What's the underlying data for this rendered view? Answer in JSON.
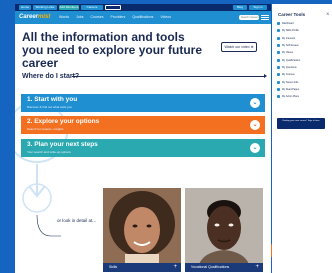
{
  "topbar": {
    "pills": [
      "Home",
      "Working Links",
      "Add Members",
      "Careers",
      "",
      "Blog",
      "Sign in"
    ]
  },
  "nav": {
    "brand_main": "Career",
    "brand_accent": "mist",
    "links": [
      "Words",
      "Jobs",
      "Courses",
      "Providers",
      "Qualifications",
      "Videos"
    ],
    "search_placeholder": "Search Careers"
  },
  "hero": {
    "title": "All the information and tools you need to explore your future career",
    "button_label": "Watch our video"
  },
  "where": {
    "heading": "Where do I start?"
  },
  "steps": [
    {
      "title": "1. Start with you",
      "subtitle": "Discover & find out what suits you",
      "color": "#1f8fd1"
    },
    {
      "title": "2. Explore your options",
      "subtitle": "Search for careers, insights",
      "color": "#f37021"
    },
    {
      "title": "3. Plan your next steps",
      "subtitle": "Your search and write-up options",
      "color": "#2aa9b0"
    }
  ],
  "detail": {
    "label": "or look in detail at..."
  },
  "cards": [
    {
      "label": "Skills",
      "icon": "plus-icon"
    },
    {
      "label": "Vocational Qualifications",
      "icon": "plus-icon"
    }
  ],
  "sidebar": {
    "title": "Career Tools",
    "close": "X",
    "items": [
      "Dashboard",
      "My Skills Profile",
      "My Interests",
      "My Self Review",
      "My Values",
      "My Qualifications",
      "My Questions",
      "My Courses",
      "My Saved Jobs",
      "My Read Pages",
      "My Action Plans"
    ],
    "promo": "Finding your next career? Sign in here"
  },
  "colors": {
    "navy": "#1a2a52",
    "blue": "#1f8fd1",
    "orange": "#f37021",
    "teal": "#2aa9b0",
    "background": "#1565c0"
  }
}
